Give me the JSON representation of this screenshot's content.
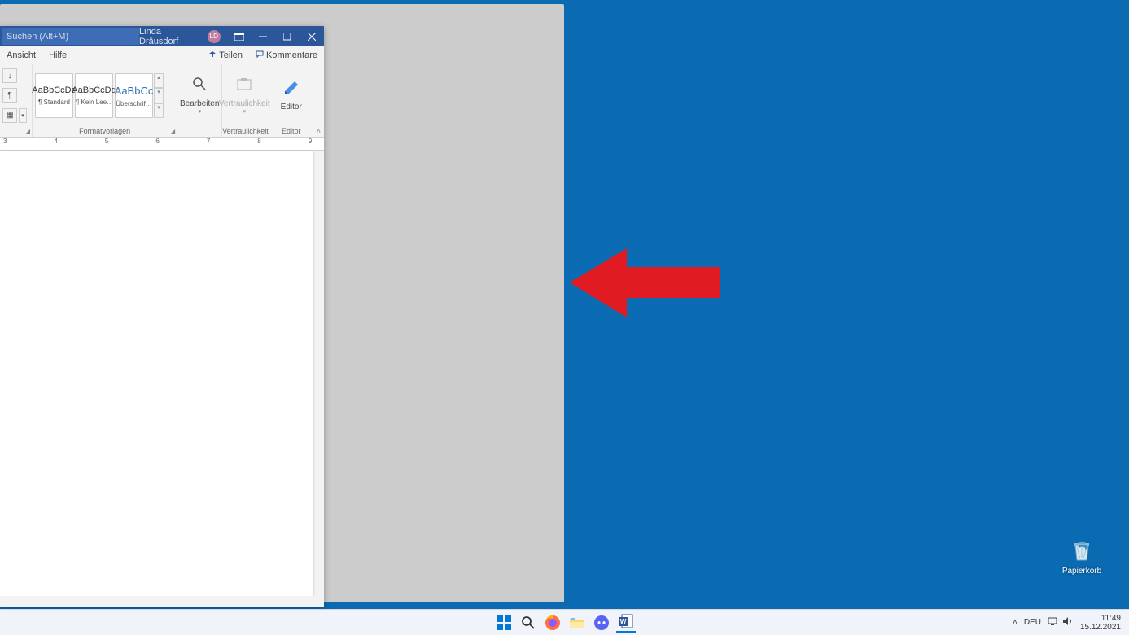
{
  "word": {
    "search_placeholder": "Suchen (Alt+M)",
    "user_name": "Linda Dräusdorf",
    "user_initials": "LD",
    "tabs": {
      "ansicht": "Ansicht",
      "hilfe": "Hilfe"
    },
    "actions": {
      "teilen": "Teilen",
      "kommentare": "Kommentare"
    },
    "ribbon": {
      "styles": {
        "preview_text": "AaBbCcDd",
        "heading_preview": "AaBbCc",
        "standard": "¶ Standard",
        "kein_leer": "¶ Kein Lee…",
        "ueberschrift": "Überschrif…",
        "group_label": "Formatvorlagen"
      },
      "bearbeiten": "Bearbeiten",
      "vertraulichkeit": "Vertraulichkeit",
      "vertraulichkeit_group": "Vertraulichkeit",
      "editor": "Editor",
      "editor_group": "Editor"
    },
    "ruler_numbers": [
      "3",
      "4",
      "5",
      "6",
      "7",
      "8",
      "9"
    ]
  },
  "desktop": {
    "recycle_bin": "Papierkorb"
  },
  "taskbar": {
    "lang": "DEU",
    "time": "11:49",
    "date": "15.12.2021"
  }
}
